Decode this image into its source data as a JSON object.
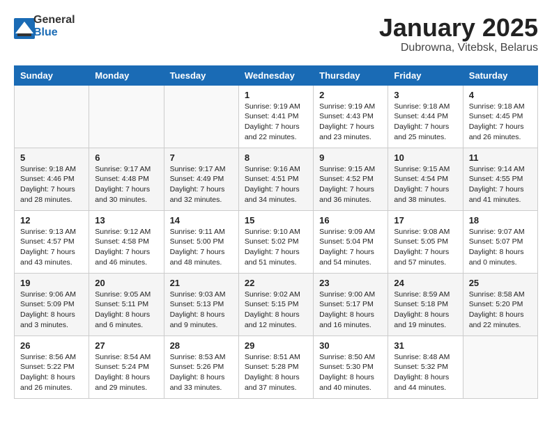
{
  "header": {
    "logo_general": "General",
    "logo_blue": "Blue",
    "month_title": "January 2025",
    "location": "Dubrowna, Vitebsk, Belarus"
  },
  "days_of_week": [
    "Sunday",
    "Monday",
    "Tuesday",
    "Wednesday",
    "Thursday",
    "Friday",
    "Saturday"
  ],
  "weeks": [
    [
      {
        "day": "",
        "info": ""
      },
      {
        "day": "",
        "info": ""
      },
      {
        "day": "",
        "info": ""
      },
      {
        "day": "1",
        "info": "Sunrise: 9:19 AM\nSunset: 4:41 PM\nDaylight: 7 hours\nand 22 minutes."
      },
      {
        "day": "2",
        "info": "Sunrise: 9:19 AM\nSunset: 4:43 PM\nDaylight: 7 hours\nand 23 minutes."
      },
      {
        "day": "3",
        "info": "Sunrise: 9:18 AM\nSunset: 4:44 PM\nDaylight: 7 hours\nand 25 minutes."
      },
      {
        "day": "4",
        "info": "Sunrise: 9:18 AM\nSunset: 4:45 PM\nDaylight: 7 hours\nand 26 minutes."
      }
    ],
    [
      {
        "day": "5",
        "info": "Sunrise: 9:18 AM\nSunset: 4:46 PM\nDaylight: 7 hours\nand 28 minutes."
      },
      {
        "day": "6",
        "info": "Sunrise: 9:17 AM\nSunset: 4:48 PM\nDaylight: 7 hours\nand 30 minutes."
      },
      {
        "day": "7",
        "info": "Sunrise: 9:17 AM\nSunset: 4:49 PM\nDaylight: 7 hours\nand 32 minutes."
      },
      {
        "day": "8",
        "info": "Sunrise: 9:16 AM\nSunset: 4:51 PM\nDaylight: 7 hours\nand 34 minutes."
      },
      {
        "day": "9",
        "info": "Sunrise: 9:15 AM\nSunset: 4:52 PM\nDaylight: 7 hours\nand 36 minutes."
      },
      {
        "day": "10",
        "info": "Sunrise: 9:15 AM\nSunset: 4:54 PM\nDaylight: 7 hours\nand 38 minutes."
      },
      {
        "day": "11",
        "info": "Sunrise: 9:14 AM\nSunset: 4:55 PM\nDaylight: 7 hours\nand 41 minutes."
      }
    ],
    [
      {
        "day": "12",
        "info": "Sunrise: 9:13 AM\nSunset: 4:57 PM\nDaylight: 7 hours\nand 43 minutes."
      },
      {
        "day": "13",
        "info": "Sunrise: 9:12 AM\nSunset: 4:58 PM\nDaylight: 7 hours\nand 46 minutes."
      },
      {
        "day": "14",
        "info": "Sunrise: 9:11 AM\nSunset: 5:00 PM\nDaylight: 7 hours\nand 48 minutes."
      },
      {
        "day": "15",
        "info": "Sunrise: 9:10 AM\nSunset: 5:02 PM\nDaylight: 7 hours\nand 51 minutes."
      },
      {
        "day": "16",
        "info": "Sunrise: 9:09 AM\nSunset: 5:04 PM\nDaylight: 7 hours\nand 54 minutes."
      },
      {
        "day": "17",
        "info": "Sunrise: 9:08 AM\nSunset: 5:05 PM\nDaylight: 7 hours\nand 57 minutes."
      },
      {
        "day": "18",
        "info": "Sunrise: 9:07 AM\nSunset: 5:07 PM\nDaylight: 8 hours\nand 0 minutes."
      }
    ],
    [
      {
        "day": "19",
        "info": "Sunrise: 9:06 AM\nSunset: 5:09 PM\nDaylight: 8 hours\nand 3 minutes."
      },
      {
        "day": "20",
        "info": "Sunrise: 9:05 AM\nSunset: 5:11 PM\nDaylight: 8 hours\nand 6 minutes."
      },
      {
        "day": "21",
        "info": "Sunrise: 9:03 AM\nSunset: 5:13 PM\nDaylight: 8 hours\nand 9 minutes."
      },
      {
        "day": "22",
        "info": "Sunrise: 9:02 AM\nSunset: 5:15 PM\nDaylight: 8 hours\nand 12 minutes."
      },
      {
        "day": "23",
        "info": "Sunrise: 9:00 AM\nSunset: 5:17 PM\nDaylight: 8 hours\nand 16 minutes."
      },
      {
        "day": "24",
        "info": "Sunrise: 8:59 AM\nSunset: 5:18 PM\nDaylight: 8 hours\nand 19 minutes."
      },
      {
        "day": "25",
        "info": "Sunrise: 8:58 AM\nSunset: 5:20 PM\nDaylight: 8 hours\nand 22 minutes."
      }
    ],
    [
      {
        "day": "26",
        "info": "Sunrise: 8:56 AM\nSunset: 5:22 PM\nDaylight: 8 hours\nand 26 minutes."
      },
      {
        "day": "27",
        "info": "Sunrise: 8:54 AM\nSunset: 5:24 PM\nDaylight: 8 hours\nand 29 minutes."
      },
      {
        "day": "28",
        "info": "Sunrise: 8:53 AM\nSunset: 5:26 PM\nDaylight: 8 hours\nand 33 minutes."
      },
      {
        "day": "29",
        "info": "Sunrise: 8:51 AM\nSunset: 5:28 PM\nDaylight: 8 hours\nand 37 minutes."
      },
      {
        "day": "30",
        "info": "Sunrise: 8:50 AM\nSunset: 5:30 PM\nDaylight: 8 hours\nand 40 minutes."
      },
      {
        "day": "31",
        "info": "Sunrise: 8:48 AM\nSunset: 5:32 PM\nDaylight: 8 hours\nand 44 minutes."
      },
      {
        "day": "",
        "info": ""
      }
    ]
  ]
}
